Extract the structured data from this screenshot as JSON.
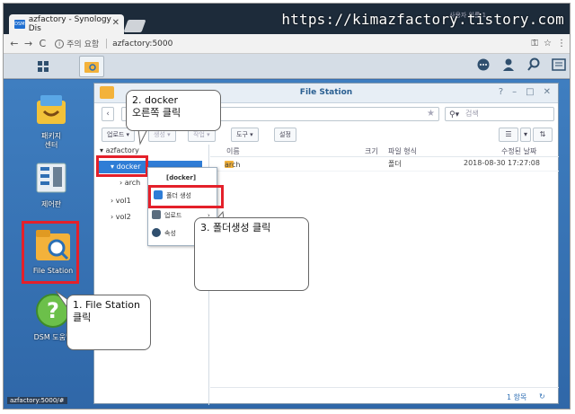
{
  "browser": {
    "tab_title": "azfactory - Synology Dis",
    "tab_favicon": "DSM",
    "profile_label": "사용자 이름 1",
    "watermark": "https://kimazfactory.tistory.com",
    "insecure_label": "주의 요함",
    "url": "azfactory:5000",
    "status_url": "azfactory:5000/#"
  },
  "desktop": {
    "icons": [
      {
        "label1": "패키지",
        "label2": "센터"
      },
      {
        "label1": "제어판",
        "label2": ""
      },
      {
        "label1": "File Station",
        "label2": ""
      },
      {
        "label1": "DSM 도움말",
        "label2": ""
      }
    ]
  },
  "file_station": {
    "title": "File Station",
    "search_placeholder": "검색",
    "toolbar": {
      "upload": "업로드",
      "create": "생성",
      "action": "작업",
      "tools": "도구",
      "settings": "설정"
    },
    "tree": {
      "root": "azfactory",
      "items": [
        "docker",
        "arch",
        "vol1",
        "vol2"
      ]
    },
    "columns": {
      "name": "이름",
      "size": "크기",
      "type": "파일 형식",
      "modified": "수정된 날짜"
    },
    "rows": [
      {
        "name": "arch",
        "type": "폴더",
        "modified": "2018-08-30 17:27:08"
      }
    ],
    "item_count": "1 항목"
  },
  "context_menu": {
    "header": "[docker]",
    "items": [
      "폴더 생성",
      "업로드",
      "속성"
    ]
  },
  "callouts": {
    "step1_line1": "1. File Station",
    "step1_line2": "클릭",
    "step2_line1": "2. docker",
    "step2_line2": "오른쪽 클릭",
    "step3": "3. 폴더생성 클릭"
  },
  "colors": {
    "highlight_red": "#e4202a",
    "select_blue": "#2f7dd6",
    "desktop_blue": "#3a6fb0"
  }
}
